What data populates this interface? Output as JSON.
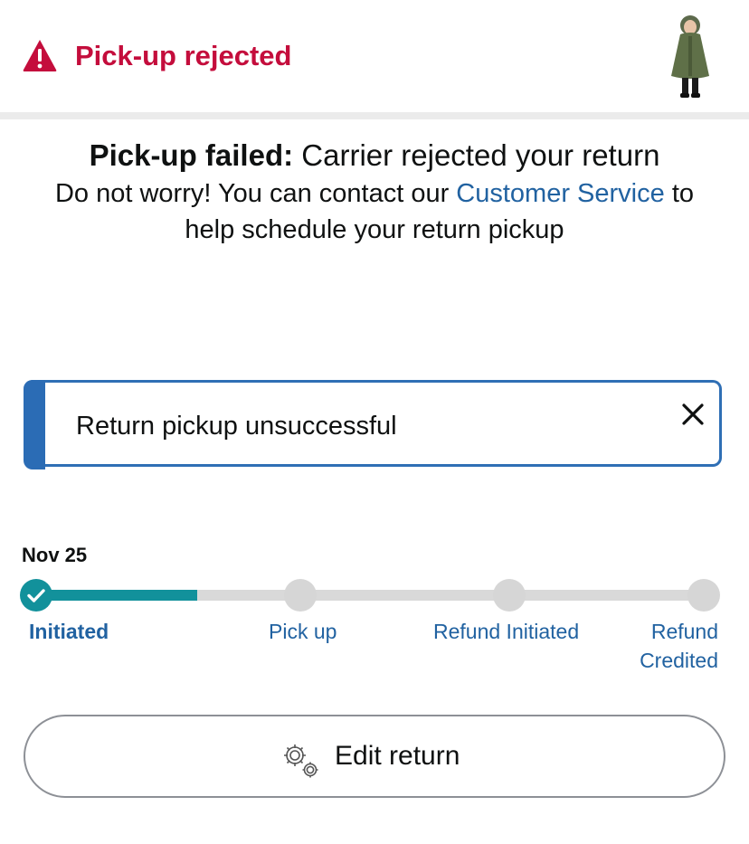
{
  "header": {
    "title": "Pick-up rejected",
    "warning_icon": "warning-triangle-icon",
    "accent_color": "#c40d3c"
  },
  "message": {
    "headline_bold": "Pick-up failed:",
    "headline_rest": " Carrier rejected your return",
    "body_before": "Do not worry! You can contact our ",
    "body_link": "Customer Service",
    "body_after": " to help schedule your return pickup"
  },
  "alert": {
    "text": "Return pickup unsuccessful",
    "close_icon": "close-icon"
  },
  "progress": {
    "date": "Nov 25",
    "steps": [
      {
        "label": "Initiated",
        "status": "done"
      },
      {
        "label": "Pick up",
        "status": "pending"
      },
      {
        "label": "Refund Initiated",
        "status": "pending"
      },
      {
        "label": "Refund Credited",
        "status": "pending"
      }
    ],
    "fill_fraction": 0.24,
    "accent_color": "#12919b"
  },
  "actions": {
    "edit_label": "Edit return",
    "edit_icon": "gear-icon"
  }
}
